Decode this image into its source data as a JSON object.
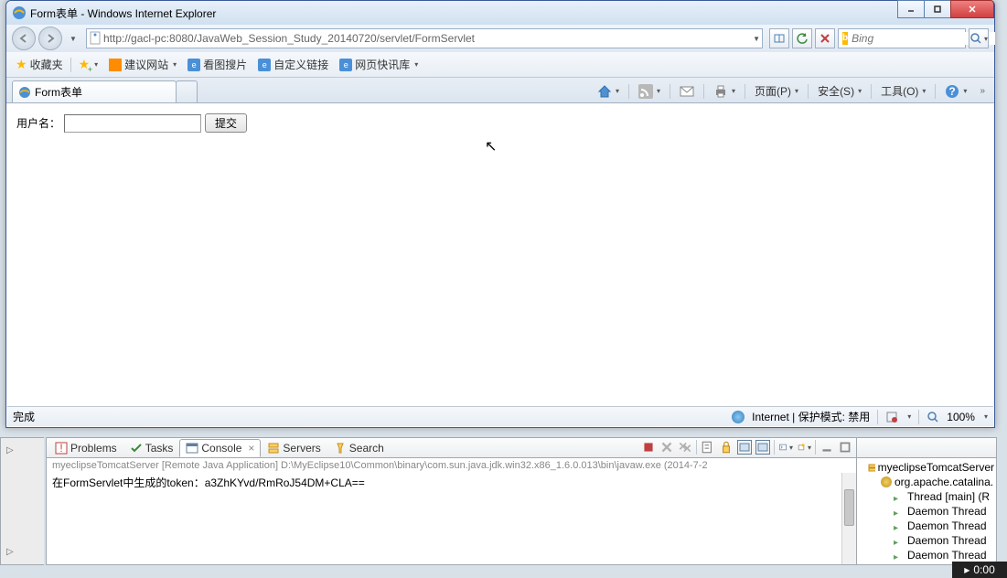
{
  "window": {
    "title": "Form表单 - Windows Internet Explorer"
  },
  "address": {
    "url": "http://gacl-pc:8080/JavaWeb_Session_Study_20140720/servlet/FormServlet"
  },
  "search": {
    "placeholder": "Bing"
  },
  "favorites": {
    "label": "收藏夹",
    "suggest": "建议网站",
    "image_search": "看图搜片",
    "custom_links": "自定义链接",
    "web_slice": "网页快讯库"
  },
  "tab": {
    "title": "Form表单"
  },
  "tools": {
    "page": "页面(P)",
    "safety": "安全(S)",
    "tools": "工具(O)"
  },
  "form": {
    "username_label": "用户名：",
    "submit_label": "提交"
  },
  "status": {
    "done": "完成",
    "zone": "Internet | 保护模式: 禁用",
    "zoom": "100%"
  },
  "eclipse": {
    "tabs": {
      "problems": "Problems",
      "tasks": "Tasks",
      "console": "Console",
      "servers": "Servers",
      "search": "Search"
    },
    "console_header": "myeclipseTomcatServer [Remote Java Application] D:\\MyEclipse10\\Common\\binary\\com.sun.java.jdk.win32.x86_1.6.0.013\\bin\\javaw.exe (2014-7-2",
    "console_line": "在FormServlet中生成的token：a3ZhKYvd/RmRoJ54DM+CLA==",
    "debug": {
      "server": "myeclipseTomcatServer",
      "catalina": "org.apache.catalina.",
      "thread_main": "Thread [main] (R",
      "daemon": "Daemon Thread"
    }
  },
  "taskbar": {
    "time": "0:00"
  }
}
